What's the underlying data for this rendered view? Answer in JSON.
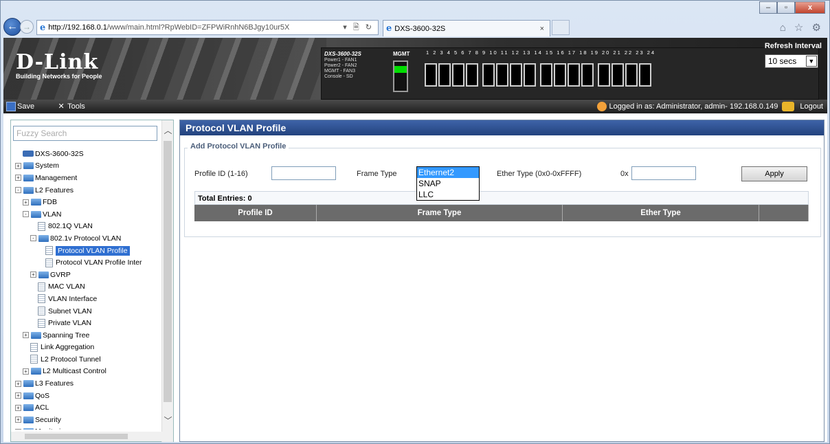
{
  "browser": {
    "url_host": "http://192.168.0.1",
    "url_path": "/www/main.html?RpWebID=ZFPWiRnhN6BJgy10ur5X",
    "url_tools": "▾ 🗎 ↻",
    "tab_title": "DXS-3600-32S",
    "tab_close": "×",
    "controls": {
      "minimize": "–",
      "maximize": "▫",
      "close": "x"
    },
    "right_icons": "⌂ ☆ ⚙"
  },
  "banner": {
    "logo_brand": "D-Link",
    "logo_tag": "Building Networks for People",
    "device_model": "DXS-3600-32S",
    "device_leds": "Power1 - FAN1\nPower2 - FAN2\nMGMT - FAN3\nConsole - SD",
    "mgmt_label": "MGMT",
    "port_numbers": "1 2 3 4 5 6 7 8 9 10 11 12 13 14 15 16 17 18 19 20 21 22 23 24",
    "refresh_label": "Refresh Interval",
    "refresh_value": "10 secs"
  },
  "toolbar": {
    "save": "Save",
    "tools": "Tools",
    "logged_in": "Logged in as: Administrator, admin- 192.168.0.149",
    "logout": "Logout"
  },
  "sidebar": {
    "search_placeholder": "Fuzzy Search",
    "tree": [
      {
        "label": "DXS-3600-32S",
        "indent": 1,
        "type": "device"
      },
      {
        "label": "System",
        "indent": 0,
        "type": "folder",
        "exp": "+"
      },
      {
        "label": "Management",
        "indent": 0,
        "type": "folder",
        "exp": "+"
      },
      {
        "label": "L2 Features",
        "indent": 0,
        "type": "folder",
        "exp": "-"
      },
      {
        "label": "FDB",
        "indent": 1,
        "type": "folder",
        "exp": "+"
      },
      {
        "label": "VLAN",
        "indent": 1,
        "type": "folder",
        "exp": "-"
      },
      {
        "label": "802.1Q VLAN",
        "indent": 3,
        "type": "doc"
      },
      {
        "label": "802.1v Protocol VLAN",
        "indent": 2,
        "type": "folder",
        "exp": "-"
      },
      {
        "label": "Protocol VLAN Profile",
        "indent": 4,
        "type": "doc",
        "selected": true
      },
      {
        "label": "Protocol VLAN Profile Inter",
        "indent": 4,
        "type": "doc"
      },
      {
        "label": "GVRP",
        "indent": 2,
        "type": "folder",
        "exp": "+"
      },
      {
        "label": "MAC VLAN",
        "indent": 3,
        "type": "doc"
      },
      {
        "label": "VLAN Interface",
        "indent": 3,
        "type": "doc"
      },
      {
        "label": "Subnet VLAN",
        "indent": 3,
        "type": "doc"
      },
      {
        "label": "Private VLAN",
        "indent": 3,
        "type": "doc"
      },
      {
        "label": "Spanning Tree",
        "indent": 1,
        "type": "folder",
        "exp": "+"
      },
      {
        "label": "Link Aggregation",
        "indent": 2,
        "type": "doc"
      },
      {
        "label": "L2 Protocol Tunnel",
        "indent": 2,
        "type": "doc"
      },
      {
        "label": "L2 Multicast Control",
        "indent": 1,
        "type": "folder",
        "exp": "+"
      },
      {
        "label": "L3 Features",
        "indent": 0,
        "type": "folder",
        "exp": "+"
      },
      {
        "label": "QoS",
        "indent": 0,
        "type": "folder",
        "exp": "+"
      },
      {
        "label": "ACL",
        "indent": 0,
        "type": "folder",
        "exp": "+"
      },
      {
        "label": "Security",
        "indent": 0,
        "type": "folder",
        "exp": "+"
      },
      {
        "label": "Monitoring",
        "indent": 0,
        "type": "folder",
        "exp": "+"
      }
    ]
  },
  "main": {
    "title": "Protocol VLAN Profile",
    "legend": "Add Protocol VLAN Profile",
    "profile_id_label": "Profile ID (1-16)",
    "profile_id_value": "",
    "frame_type_label": "Frame Type",
    "frame_type_options": [
      "Ethernet2",
      "SNAP",
      "LLC"
    ],
    "frame_type_selected": "Ethernet2",
    "ether_type_label": "Ether Type (0x0-0xFFFF)",
    "ether_prefix": "0x",
    "ether_value": "",
    "apply": "Apply",
    "total_entries": "Total Entries: 0",
    "columns": [
      "Profile ID",
      "Frame Type",
      "Ether Type",
      ""
    ]
  }
}
